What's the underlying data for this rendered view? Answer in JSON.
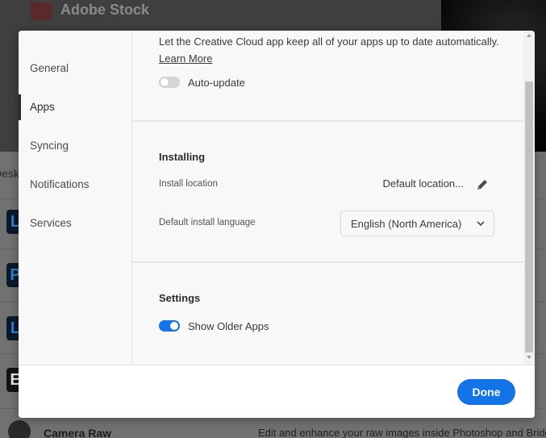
{
  "background": {
    "banner_title": "Adobe Stock",
    "desk_label": "Desk",
    "app_icons": [
      "L",
      "P",
      "L",
      "E"
    ],
    "camera_raw": {
      "name": "Camera Raw",
      "description": "Edit and enhance your raw images inside Photoshop and Bridge"
    }
  },
  "sidebar": {
    "items": [
      {
        "label": "General",
        "active": false
      },
      {
        "label": "Apps",
        "active": true
      },
      {
        "label": "Syncing",
        "active": false
      },
      {
        "label": "Notifications",
        "active": false
      },
      {
        "label": "Services",
        "active": false
      }
    ]
  },
  "auto_update": {
    "description": "Let the Creative Cloud app keep all of your apps up to date automatically.",
    "learn_more": "Learn More",
    "toggle_label": "Auto-update",
    "enabled": false
  },
  "installing": {
    "heading": "Installing",
    "location_label": "Install location",
    "location_value": "Default location...",
    "language_label": "Default install language",
    "language_value": "English (North America)"
  },
  "settings": {
    "heading": "Settings",
    "older_apps_label": "Show Older Apps",
    "older_apps_enabled": true
  },
  "footer": {
    "done_label": "Done"
  },
  "colors": {
    "accent": "#1473e6",
    "toggle_off": "#d6d6d6"
  }
}
